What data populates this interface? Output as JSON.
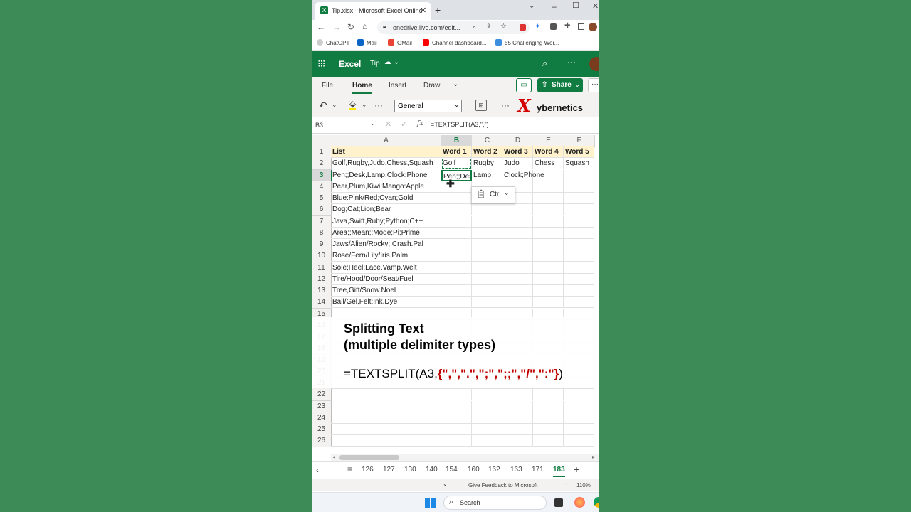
{
  "browser": {
    "tab_title": "Tip.xlsx - Microsoft Excel Online",
    "url": "onedrive.live.com/edit...",
    "bookmarks": [
      "ChatGPT",
      "Mail",
      "GMail",
      "Channel dashboard...",
      "55 Challenging Wor..."
    ]
  },
  "excel": {
    "app_name": "Excel",
    "file_name": "Tip",
    "ribbon_tabs": [
      "File",
      "Home",
      "Insert",
      "Draw"
    ],
    "share_label": "Share",
    "number_format": "General",
    "brand_x": "X",
    "brand_text": "ybernetics",
    "name_box": "B3",
    "fx": "fx",
    "formula": "=TEXTSPLIT(A3,\",\")"
  },
  "grid": {
    "columns": [
      "A",
      "B",
      "C",
      "D",
      "E",
      "F"
    ],
    "rows": [
      [
        "List",
        "Word 1",
        "Word 2",
        "Word 3",
        "Word 4",
        "Word 5"
      ],
      [
        "Golf,Rugby,Judo,Chess,Squash",
        "Golf",
        "Rugby",
        "Judo",
        "Chess",
        "Squash"
      ],
      [
        "Pen;;Desk,Lamp,Clock;Phone",
        "Pen;;Desk",
        "Lamp",
        "Clock;Phone",
        "",
        ""
      ],
      [
        "Pear,Plum,Kiwi;Mango:Apple",
        "",
        "",
        "",
        "",
        ""
      ],
      [
        "Blue:Pink/Red;Cyan;Gold",
        "",
        "",
        "",
        "",
        ""
      ],
      [
        "Dog;Cat;Lion;Bear",
        "",
        "",
        "",
        "",
        ""
      ],
      [
        "Java,Swift,Ruby;Python;C++",
        "",
        "",
        "",
        "",
        ""
      ],
      [
        "Area;;Mean;;Mode;Pi;Prime",
        "",
        "",
        "",
        "",
        ""
      ],
      [
        "Jaws/Alien/Rocky;;Crash.Pal",
        "",
        "",
        "",
        "",
        ""
      ],
      [
        "Rose/Fern/Lily/Iris.Palm",
        "",
        "",
        "",
        "",
        ""
      ],
      [
        "Sole;Heel;Lace.Vamp.Welt",
        "",
        "",
        "",
        "",
        ""
      ],
      [
        "Tire/Hood/Door/Seat/Fuel",
        "",
        "",
        "",
        "",
        ""
      ],
      [
        "Tree,Gift/Snow.Noel",
        "",
        "",
        "",
        "",
        ""
      ],
      [
        "   Ball/Gel,Felt;Ink.Dye",
        "",
        "",
        "",
        "",
        ""
      ]
    ],
    "row_numbers": [
      "1",
      "2",
      "3",
      "4",
      "5",
      "6",
      "7",
      "8",
      "9",
      "10",
      "11",
      "12",
      "13",
      "14",
      "15",
      "16",
      "17",
      "18",
      "19",
      "20",
      "21",
      "22",
      "23",
      "24",
      "25",
      "26"
    ],
    "paste_popup": "Ctrl"
  },
  "overlay": {
    "title_line1": "Splitting Text",
    "title_line2": "(multiple delimiter types)",
    "formula_prefix": "=TEXTSPLIT(A3,",
    "formula_array": "{\",\",\".\",\";\",\";;\",\"/\",\":\"}",
    "formula_suffix": ")",
    "array_color": "#c00000"
  },
  "sheets": {
    "tabs": [
      "126",
      "127",
      "130",
      "140",
      "154",
      "160",
      "162",
      "163",
      "171",
      "183"
    ],
    "active": "183"
  },
  "status": {
    "feedback": "Give Feedback to Microsoft",
    "zoom": "110%"
  },
  "taskbar": {
    "search_placeholder": "Search"
  },
  "colors": {
    "excel_green": "#107c41",
    "header_yellow": "#fff2cc",
    "background_green": "#3d8c57"
  }
}
